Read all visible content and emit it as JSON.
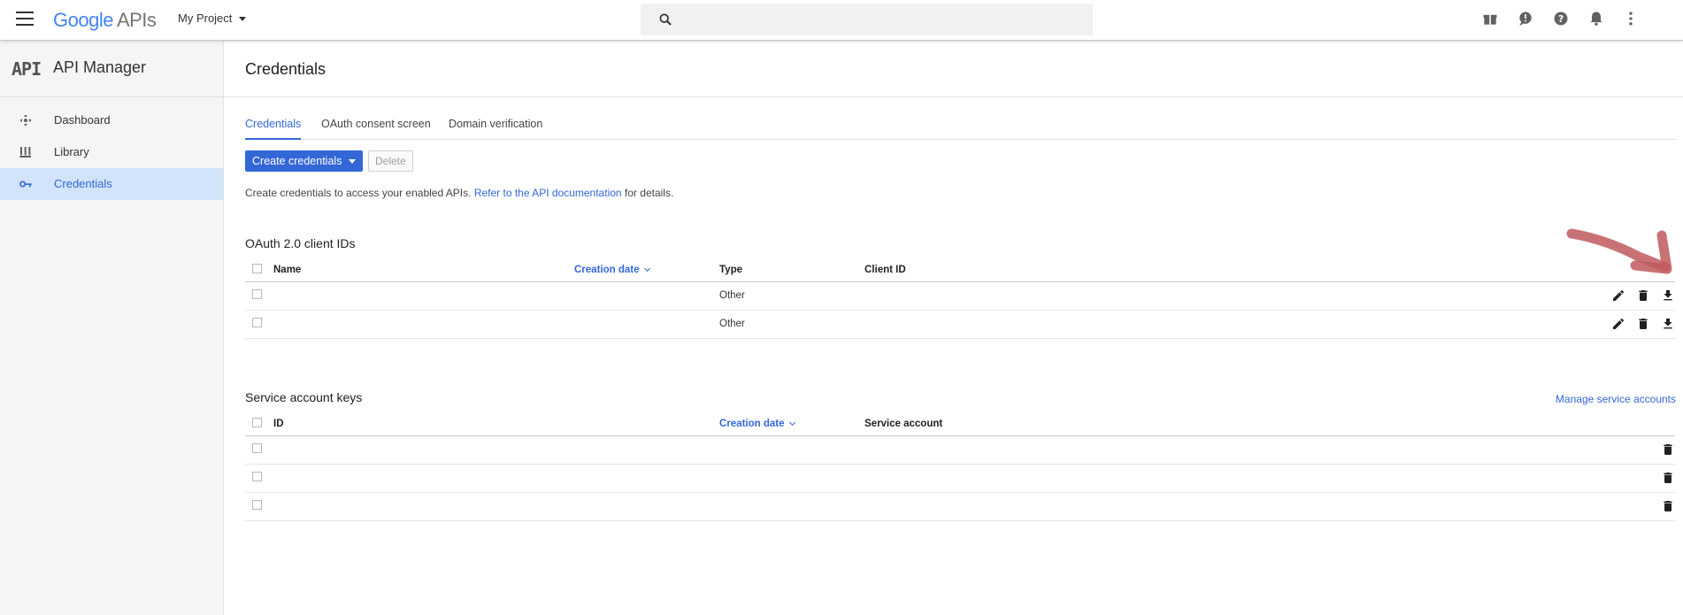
{
  "header": {
    "logo_google": "Google",
    "logo_apis": "APIs",
    "project": "My Project",
    "icons": [
      "menu-icon",
      "search-icon",
      "gift-icon",
      "feedback-icon",
      "help-icon",
      "notifications-icon",
      "more-vert-icon"
    ]
  },
  "sidebar": {
    "logo": "API",
    "title": "API Manager",
    "items": [
      {
        "label": "Dashboard",
        "icon": "dashboard-icon"
      },
      {
        "label": "Library",
        "icon": "library-icon"
      },
      {
        "label": "Credentials",
        "icon": "key-icon"
      }
    ]
  },
  "page": {
    "title": "Credentials",
    "tabs": [
      "Credentials",
      "OAuth consent screen",
      "Domain verification"
    ],
    "create_button": "Create credentials",
    "delete_button": "Delete",
    "info_prefix": "Create credentials to access your enabled APIs. ",
    "info_link": "Refer to the API documentation",
    "info_suffix": " for details."
  },
  "oauth": {
    "title": "OAuth 2.0 client IDs",
    "columns": {
      "name": "Name",
      "date": "Creation date",
      "type": "Type",
      "client_id": "Client ID"
    },
    "rows": [
      {
        "name": "",
        "date": "",
        "type": "Other",
        "client_id": ""
      },
      {
        "name": "",
        "date": "",
        "type": "Other",
        "client_id": ""
      }
    ]
  },
  "service": {
    "title": "Service account keys",
    "manage_link": "Manage service accounts",
    "columns": {
      "id": "ID",
      "date": "Creation date",
      "account": "Service account"
    },
    "rows": [
      {
        "id": "",
        "date": "",
        "account": ""
      },
      {
        "id": "",
        "date": "",
        "account": ""
      },
      {
        "id": "",
        "date": "",
        "account": ""
      }
    ]
  },
  "annotation_color": "#c0595e"
}
